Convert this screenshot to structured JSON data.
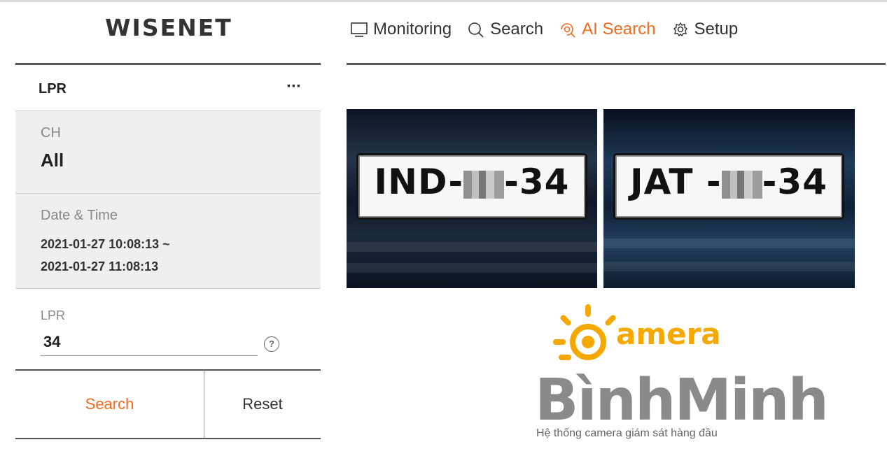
{
  "brand": {
    "logo": "WISENET"
  },
  "nav": {
    "items": [
      {
        "label": "Monitoring",
        "icon": "monitor-icon",
        "active": false
      },
      {
        "label": "Search",
        "icon": "search-icon",
        "active": false
      },
      {
        "label": "AI Search",
        "icon": "ai-search-icon",
        "active": true
      },
      {
        "label": "Setup",
        "icon": "gear-icon",
        "active": false
      }
    ],
    "accent_color": "#f26b21"
  },
  "panel": {
    "title": "LPR",
    "more": "···",
    "channel": {
      "label": "CH",
      "value": "All"
    },
    "datetime": {
      "label": "Date & Time",
      "start": "2021-01-27 10:08:13 ~",
      "end": "2021-01-27 11:08:13"
    },
    "lpr": {
      "label": "LPR",
      "value": "34"
    },
    "help": "?",
    "buttons": {
      "search": "Search",
      "reset": "Reset"
    }
  },
  "results": [
    {
      "prefix": "IND-",
      "suffix": "-34"
    },
    {
      "prefix": "JAT -",
      "suffix": "-34"
    }
  ],
  "watermark": {
    "camera": "amera",
    "binhminh": "BìnhMinh",
    "tagline": "Hệ thống camera giám sát hàng đầu"
  }
}
